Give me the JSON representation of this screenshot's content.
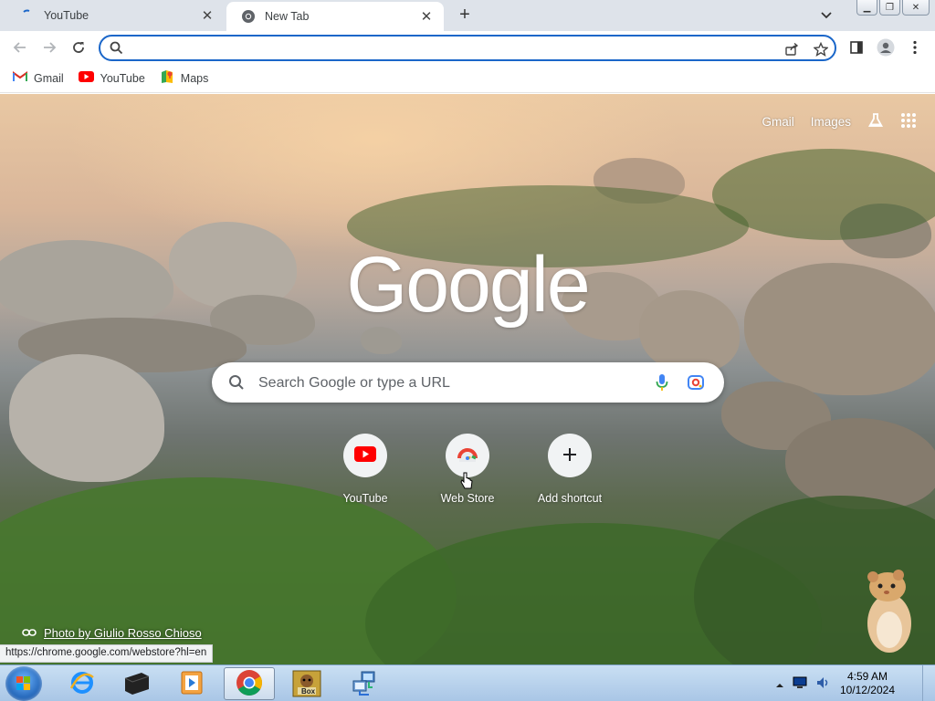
{
  "browser": {
    "tabs": [
      {
        "title": "YouTube",
        "icon": "youtube-loading-icon",
        "active": false
      },
      {
        "title": "New Tab",
        "icon": "chrome-icon",
        "active": true
      }
    ],
    "new_tab_symbol": "+",
    "omnibox_value": ""
  },
  "bookmarks": [
    {
      "label": "Gmail",
      "icon": "gmail-icon"
    },
    {
      "label": "YouTube",
      "icon": "youtube-icon"
    },
    {
      "label": "Maps",
      "icon": "maps-icon"
    }
  ],
  "ntp": {
    "top_links": {
      "gmail": "Gmail",
      "images": "Images"
    },
    "logo": "Google",
    "search_placeholder": "Search Google or type a URL",
    "shortcuts": [
      {
        "label": "YouTube",
        "icon": "youtube-icon"
      },
      {
        "label": "Web Store",
        "icon": "web-store-icon"
      },
      {
        "label": "Add shortcut",
        "icon": "plus-icon"
      }
    ],
    "credit": "Photo by Giulio Rosso Chioso"
  },
  "status_url": "https://chrome.google.com/webstore?hl=en",
  "taskbar": {
    "time": "4:59 AM",
    "date": "10/12/2024",
    "sandbox_label": "Box"
  },
  "colors": {
    "omnibox_border": "#1a66c9",
    "youtube_red": "#ff0000",
    "taskbar": "#b7d0ec"
  }
}
